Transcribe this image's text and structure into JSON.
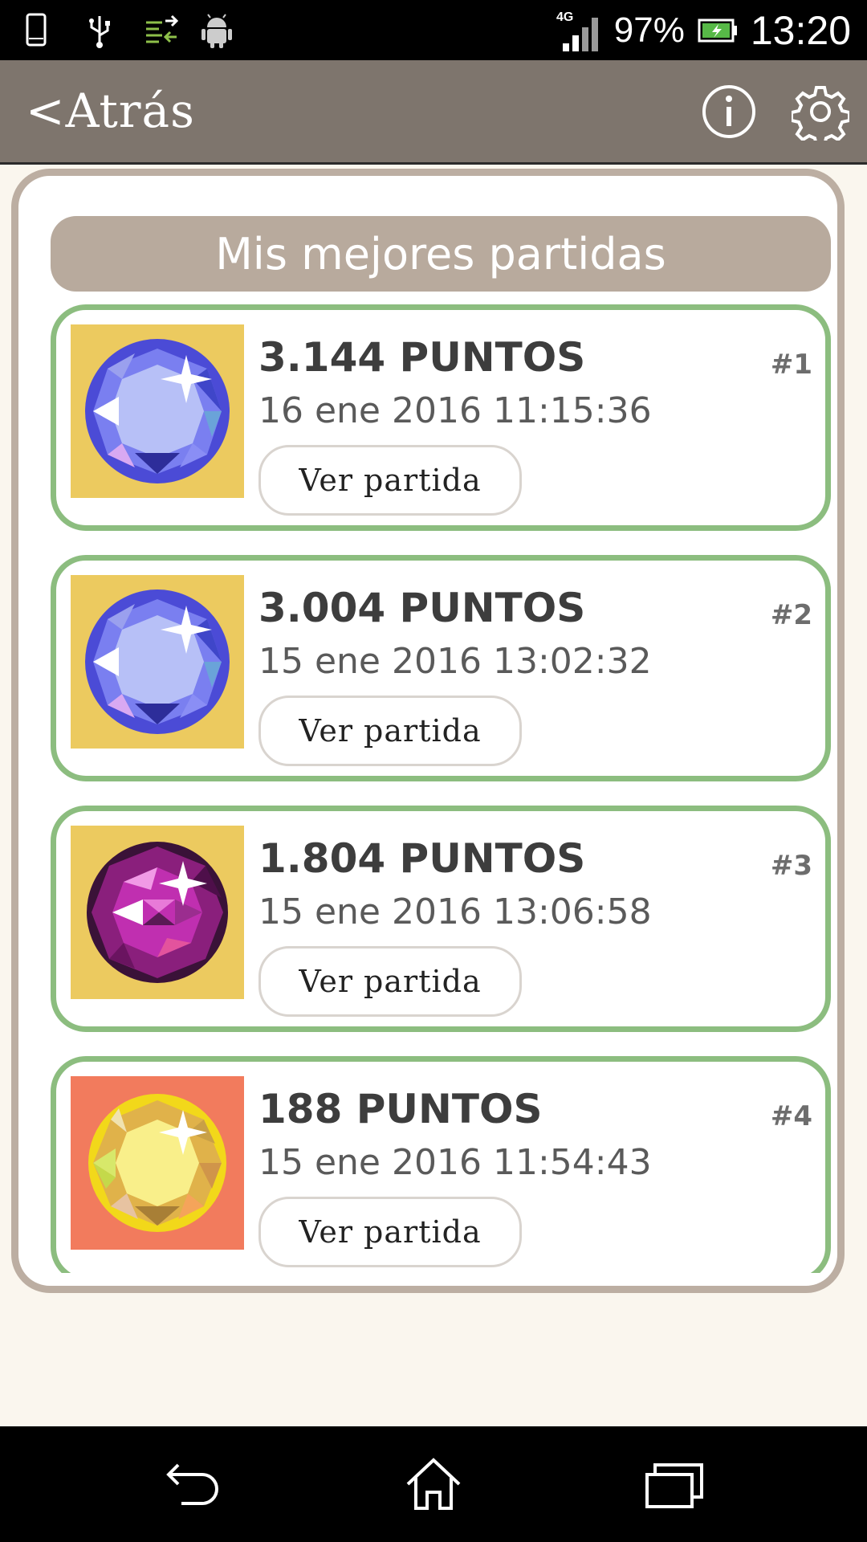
{
  "status_bar": {
    "network": "4G",
    "battery": "97%",
    "time": "13:20",
    "icons": [
      "phone-outline-icon",
      "usb-icon",
      "data-transfer-icon",
      "android-icon",
      "signal-icon",
      "battery-icon"
    ]
  },
  "app_bar": {
    "back_label": "<Atrás",
    "info_icon": "info-icon",
    "settings_icon": "gear-icon"
  },
  "panel": {
    "title": "Mis mejores partidas"
  },
  "games": [
    {
      "score": "3.144 PUNTOS",
      "date": "16 ene 2016  11:15:36",
      "rank": "#1",
      "button": "Ver partida",
      "tile_color": "#ecca5f",
      "gem": "blue-gem-icon"
    },
    {
      "score": "3.004 PUNTOS",
      "date": "15 ene 2016  13:02:32",
      "rank": "#2",
      "button": "Ver partida",
      "tile_color": "#ecca5f",
      "gem": "blue-gem-icon"
    },
    {
      "score": "1.804 PUNTOS",
      "date": "15 ene 2016  13:06:58",
      "rank": "#3",
      "button": "Ver partida",
      "tile_color": "#ecca5f",
      "gem": "purple-gem-icon"
    },
    {
      "score": "188 PUNTOS",
      "date": "15 ene 2016  11:54:43",
      "rank": "#4",
      "button": "Ver partida",
      "tile_color": "#f27b5d",
      "gem": "yellow-gem-icon"
    }
  ],
  "nav_bar": {
    "icons": [
      "back-icon",
      "home-icon",
      "recent-apps-icon"
    ]
  },
  "colors": {
    "app_bar": "#7e756d",
    "card_border": "#8cbd7f",
    "panel_border": "#bcaea2",
    "title_bg": "#b8aa9d"
  }
}
